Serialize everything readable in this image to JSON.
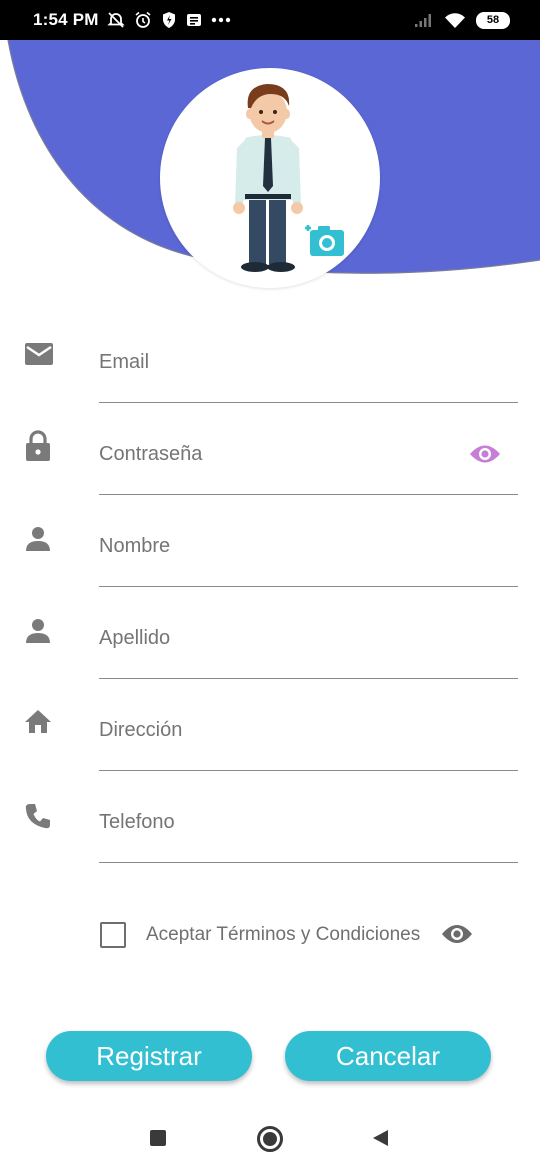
{
  "status_bar": {
    "time": "1:54 PM",
    "icons": [
      "no-alarm-off-icon",
      "alarm-icon",
      "shield-icon",
      "notification-icon",
      "more-dots-icon",
      "signal-icon",
      "wifi-icon"
    ],
    "battery": "58"
  },
  "colors": {
    "header": "#5b67d4",
    "accent": "#33bfd2",
    "password_eye": "#c77fd6",
    "icon_gray": "#7a7a7a"
  },
  "form": {
    "email_placeholder": "Email",
    "password_placeholder": "Contraseña",
    "name_placeholder": "Nombre",
    "lastname_placeholder": "Apellido",
    "address_placeholder": "Dirección",
    "phone_placeholder": "Telefono",
    "terms_label": "Aceptar Términos y Condiciones",
    "terms_checked": false
  },
  "buttons": {
    "register": "Registrar",
    "cancel": "Cancelar"
  }
}
